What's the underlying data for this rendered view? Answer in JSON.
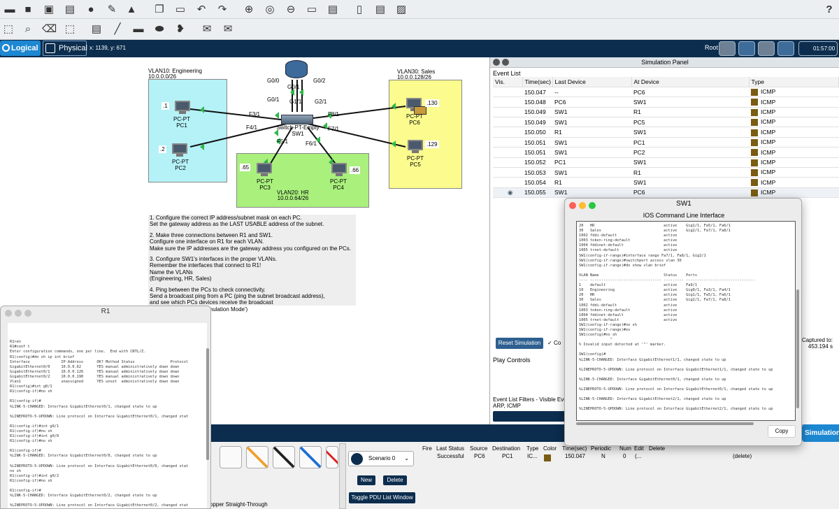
{
  "toolbar": {
    "help": "?"
  },
  "topbar": {
    "logical": "Logical",
    "physical": "Physical",
    "coords": "x: 1139, y: 671",
    "root": "Root",
    "clock": "01:57:00"
  },
  "topology": {
    "vlan10": {
      "name": "VLAN10: Engineering",
      "net": "10.0.0.0/26"
    },
    "vlan20": {
      "name": "VLAN20: HR",
      "net": "10.0.0.64/26"
    },
    "vlan30": {
      "name": "VLAN30: Sales",
      "net": "10.0.0.128/26"
    },
    "router": {
      "g00": "G0/0",
      "g01": "G0/1",
      "g02": "G0/2"
    },
    "switch": {
      "name1": "Switch-PT-Empty",
      "name2": "SW1",
      "g11": "G1/1",
      "g21": "G2/1",
      "g01": "G0/1",
      "f31": "F3/1",
      "f41": "F4/1",
      "f51": "F5/1",
      "f61": "F6/1",
      "f71": "F7/1",
      "f81": "F8/1"
    },
    "pcs": [
      {
        "type": "PC-PT",
        "name": "PC1",
        "ip": ".1"
      },
      {
        "type": "PC-PT",
        "name": "PC2",
        "ip": ".2"
      },
      {
        "type": "PC-PT",
        "name": "PC3",
        "ip": ".65"
      },
      {
        "type": "PC-PT",
        "name": "PC4",
        "ip": ".66"
      },
      {
        "type": "PC-PT",
        "name": "PC6",
        "ip": ".130"
      },
      {
        "type": "PC-PT",
        "name": "PC5",
        "ip": ".129"
      }
    ]
  },
  "instructions": [
    "1. Configure the correct IP address/subnet mask on each PC.",
    "    Set the gateway address as the LAST USABLE address of the subnet.",
    "2. Make three connections between R1 and SW1.",
    "    Configure one interface on R1 for each VLAN.",
    "    Make sure the IP addresses are the gateway address you configured on the PCs.",
    "3. Configure SW1's interfaces in the proper VLANs.",
    "    Remember the interfaces that connect to R1!",
    "    Name the VLANs",
    "     (Engineering, HR, Sales)",
    "4. Ping between the PCs to check connectivity.",
    "    Send a broadcast ping from a PC (ping the subnet broadcast address),",
    "     and see which PCs devices receive the broadcast",
    "     (use Packet Tracer's 'Simulation Mode')"
  ],
  "sim": {
    "title": "Simulation Panel",
    "event_list_label": "Event List",
    "columns": [
      "Vis.",
      "Time(sec)",
      "Last Device",
      "At Device",
      "Type"
    ],
    "rows": [
      [
        "",
        "150.047",
        "--",
        "PC6",
        "ICMP"
      ],
      [
        "",
        "150.048",
        "PC6",
        "SW1",
        "ICMP"
      ],
      [
        "",
        "150.049",
        "SW1",
        "R1",
        "ICMP"
      ],
      [
        "",
        "150.049",
        "SW1",
        "PC5",
        "ICMP"
      ],
      [
        "",
        "150.050",
        "R1",
        "SW1",
        "ICMP"
      ],
      [
        "",
        "150.051",
        "SW1",
        "PC1",
        "ICMP"
      ],
      [
        "",
        "150.051",
        "SW1",
        "PC2",
        "ICMP"
      ],
      [
        "",
        "150.052",
        "PC1",
        "SW1",
        "ICMP"
      ],
      [
        "",
        "150.053",
        "SW1",
        "R1",
        "ICMP"
      ],
      [
        "",
        "150.054",
        "R1",
        "SW1",
        "ICMP"
      ],
      [
        "",
        "150.055",
        "SW1",
        "PC6",
        "ICMP"
      ]
    ],
    "type_color": "#7a5c12",
    "reset": "Reset Simulation",
    "constant_delay": "Co",
    "captured_label": "Captured to:",
    "captured_value": "453.194 s",
    "play_controls": "Play Controls",
    "filters_label": "Event List Filters - Visible Eve",
    "filters_value": "ARP, ICMP"
  },
  "sw1": {
    "title": "SW1",
    "subtitle": "IOS Command Line Interface",
    "lines": [
      "20   HR                               active    Gig1/1, Fa5/1, Fa6/1",
      "30   Sales                            active    Gig2/1, Fa7/1, Fa8/1",
      "1002 fddi-default                     active",
      "1003 token-ring-default               active",
      "1004 fddinet-default                  active",
      "1005 trnet-default                    active",
      "SW1(config-if-range)#interface range Fa7/1, Fa8/1, Gig2/1",
      "SW1(config-if-range)#switchport access vlan 30",
      "SW1(config-if-range)#do show vlan brief",
      "",
      "VLAN Name                             Status    Ports",
      "---- -------------------------------- --------- -------------------------------",
      "1    default                          active    Fa9/1",
      "10   Engineering                      active    Gig0/1, Fa3/1, Fa4/1",
      "20   HR                               active    Gig1/1, Fa5/1, Fa6/1",
      "30   Sales                            active    Gig2/1, Fa7/1, Fa8/1",
      "1002 fddi-default                     active",
      "1003 token-ring-default               active",
      "1004 fddinet-default                  active",
      "1005 trnet-default                    active",
      "SW1(config-if-range)#no sh",
      "SW1(config-if-range)#ex",
      "SW1(config)#no sh",
      "              ^",
      "% Invalid input detected at '^' marker.",
      "",
      "SW1(config)#",
      "%LINK-5-CHANGED: Interface GigabitEthernet1/1, changed state to up",
      "",
      "%LINEPROTO-5-UPDOWN: Line protocol on Interface GigabitEthernet1/1, changed state to up",
      "",
      "%LINK-5-CHANGED: Interface GigabitEthernet0/1, changed state to up",
      "",
      "%LINEPROTO-5-UPDOWN: Line protocol on Interface GigabitEthernet0/1, changed state to up",
      "",
      "%LINK-5-CHANGED: Interface GigabitEthernet2/1, changed state to up",
      "",
      "%LINEPROTO-5-UPDOWN: Line protocol on Interface GigabitEthernet2/1, changed state to up"
    ],
    "copy": "Copy"
  },
  "r1": {
    "title": "R1",
    "lines": [
      "",
      "",
      "",
      "R1>en",
      "R1#conf t",
      "Enter configuration commands, one per line.  End with CNTL/Z.",
      "R1(config)#do sh ip int brief",
      "Interface              IP-Address      OK? Method Status                Protocol",
      "GigabitEthernet0/0     10.0.0.62       YES manual administratively down down",
      "GigabitEthernet0/1     10.0.0.126      YES manual administratively down down",
      "GigabitEthernet0/2     10.0.0.190      YES manual administratively down down",
      "Vlan1                  unassigned      YES unset  administratively down down",
      "R1(config)#int g0/1",
      "R1(config-if)#no sh",
      "",
      "R1(config-if)#",
      "%LINK-5-CHANGED: Interface GigabitEthernet0/1, changed state to up",
      "",
      "%LINEPROTO-5-UPDOWN: Line protocol on Interface GigabitEthernet0/1, changed stat",
      "",
      "R1(config-if)#int g0/1",
      "R1(config-if)#no sh",
      "R1(config-if)#int g0/0",
      "R1(config-if)#no sh",
      "",
      "R1(config-if)#",
      "%LINK-5-CHANGED: Interface GigabitEthernet0/0, changed state to up",
      "",
      "%LINEPROTO-5-UPDOWN: Line protocol on Interface GigabitEthernet0/0, changed stat",
      "no sh",
      "R1(config-if)#int g0/2",
      "R1(config-if)#no sh",
      "",
      "R1(config-if)#",
      "%LINK-5-CHANGED: Interface GigabitEthernet0/2, changed state to up",
      "",
      "%LINEPROTO-5-UPDOWN: Line protocol on Interface GigabitEthernet0/2, changed stat"
    ]
  },
  "bottom": {
    "scenario": "Scenario 0",
    "new": "New",
    "delete": "Delete",
    "toggle": "Toggle PDU List Window",
    "simulation": "Simulation",
    "connection": "opper Straight-Through",
    "pdu_headers": [
      "Fire",
      "Last Status",
      "Source",
      "Destination",
      "Type",
      "Color",
      "Time(sec)",
      "Periodic",
      "Num",
      "Edit",
      "Delete"
    ],
    "pdu_row": [
      "",
      "Successful",
      "PC6",
      "PC1",
      "IC...",
      "",
      "150.047",
      "N",
      "0",
      "(...",
      "(delete)"
    ]
  }
}
